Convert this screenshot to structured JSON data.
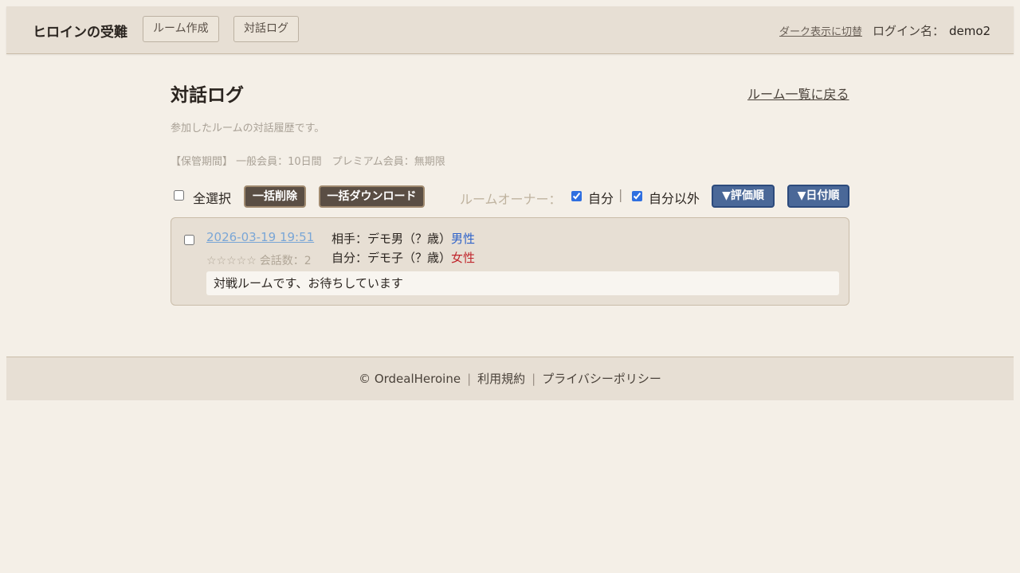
{
  "header": {
    "brand": "ヒロインの受難",
    "nav": [
      "ルーム作成",
      "対話ログ"
    ],
    "dark_toggle": "ダーク表示に切替",
    "login_label": "ログイン名：",
    "username": "demo2"
  },
  "page": {
    "title": "対話ログ",
    "back_link": "ルーム一覧に戻る",
    "description": "参加したルームの対話履歴です。",
    "retention": "【保管期間】 一般会員：10日間　プレミアム会員：無期限"
  },
  "toolbar": {
    "select_all": "全選択",
    "bulk_delete": "一括削除",
    "bulk_download": "一括ダウンロード",
    "owner_label": "ルームオーナー：",
    "own_label": "自分",
    "separator": "|",
    "other_label": "自分以外",
    "sort_rating": "▼評価順",
    "sort_date": "▼日付順"
  },
  "logs": [
    {
      "date": "2026-03-19 19:51",
      "stars": "☆☆☆☆☆",
      "turns": "会話数：2",
      "partner_prefix": "相手：デモ男（？歳）",
      "partner_gender": "男性",
      "self_prefix": "自分：デモ子（？歳）",
      "self_gender": "女性",
      "message": "対戦ルームです、お待ちしています"
    }
  ],
  "footer": {
    "copyright": "© OrdealHeroine",
    "terms": "利用規約",
    "privacy": "プライバシーポリシー",
    "separator": "|"
  },
  "colors": {
    "background": "#f4efe7",
    "panel": "#e7dfd4",
    "accent_blue": "#4a6898",
    "dark_button": "#5a4e44",
    "male": "#2e62c9",
    "female": "#c0262d"
  }
}
